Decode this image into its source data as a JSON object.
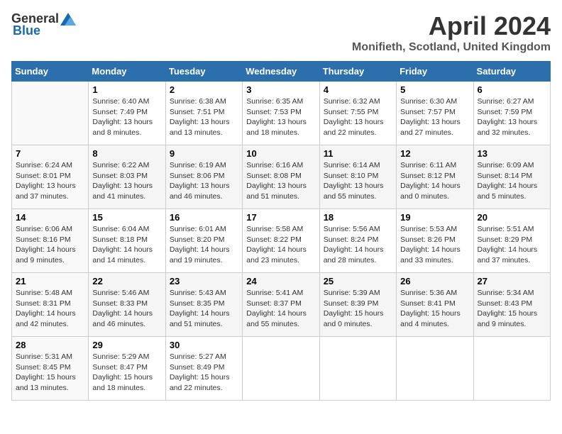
{
  "header": {
    "logo_general": "General",
    "logo_blue": "Blue",
    "month_title": "April 2024",
    "location": "Monifieth, Scotland, United Kingdom"
  },
  "days_of_week": [
    "Sunday",
    "Monday",
    "Tuesday",
    "Wednesday",
    "Thursday",
    "Friday",
    "Saturday"
  ],
  "weeks": [
    [
      {
        "num": "",
        "info": ""
      },
      {
        "num": "1",
        "info": "Sunrise: 6:40 AM\nSunset: 7:49 PM\nDaylight: 13 hours\nand 8 minutes."
      },
      {
        "num": "2",
        "info": "Sunrise: 6:38 AM\nSunset: 7:51 PM\nDaylight: 13 hours\nand 13 minutes."
      },
      {
        "num": "3",
        "info": "Sunrise: 6:35 AM\nSunset: 7:53 PM\nDaylight: 13 hours\nand 18 minutes."
      },
      {
        "num": "4",
        "info": "Sunrise: 6:32 AM\nSunset: 7:55 PM\nDaylight: 13 hours\nand 22 minutes."
      },
      {
        "num": "5",
        "info": "Sunrise: 6:30 AM\nSunset: 7:57 PM\nDaylight: 13 hours\nand 27 minutes."
      },
      {
        "num": "6",
        "info": "Sunrise: 6:27 AM\nSunset: 7:59 PM\nDaylight: 13 hours\nand 32 minutes."
      }
    ],
    [
      {
        "num": "7",
        "info": "Sunrise: 6:24 AM\nSunset: 8:01 PM\nDaylight: 13 hours\nand 37 minutes."
      },
      {
        "num": "8",
        "info": "Sunrise: 6:22 AM\nSunset: 8:03 PM\nDaylight: 13 hours\nand 41 minutes."
      },
      {
        "num": "9",
        "info": "Sunrise: 6:19 AM\nSunset: 8:06 PM\nDaylight: 13 hours\nand 46 minutes."
      },
      {
        "num": "10",
        "info": "Sunrise: 6:16 AM\nSunset: 8:08 PM\nDaylight: 13 hours\nand 51 minutes."
      },
      {
        "num": "11",
        "info": "Sunrise: 6:14 AM\nSunset: 8:10 PM\nDaylight: 13 hours\nand 55 minutes."
      },
      {
        "num": "12",
        "info": "Sunrise: 6:11 AM\nSunset: 8:12 PM\nDaylight: 14 hours\nand 0 minutes."
      },
      {
        "num": "13",
        "info": "Sunrise: 6:09 AM\nSunset: 8:14 PM\nDaylight: 14 hours\nand 5 minutes."
      }
    ],
    [
      {
        "num": "14",
        "info": "Sunrise: 6:06 AM\nSunset: 8:16 PM\nDaylight: 14 hours\nand 9 minutes."
      },
      {
        "num": "15",
        "info": "Sunrise: 6:04 AM\nSunset: 8:18 PM\nDaylight: 14 hours\nand 14 minutes."
      },
      {
        "num": "16",
        "info": "Sunrise: 6:01 AM\nSunset: 8:20 PM\nDaylight: 14 hours\nand 19 minutes."
      },
      {
        "num": "17",
        "info": "Sunrise: 5:58 AM\nSunset: 8:22 PM\nDaylight: 14 hours\nand 23 minutes."
      },
      {
        "num": "18",
        "info": "Sunrise: 5:56 AM\nSunset: 8:24 PM\nDaylight: 14 hours\nand 28 minutes."
      },
      {
        "num": "19",
        "info": "Sunrise: 5:53 AM\nSunset: 8:26 PM\nDaylight: 14 hours\nand 33 minutes."
      },
      {
        "num": "20",
        "info": "Sunrise: 5:51 AM\nSunset: 8:29 PM\nDaylight: 14 hours\nand 37 minutes."
      }
    ],
    [
      {
        "num": "21",
        "info": "Sunrise: 5:48 AM\nSunset: 8:31 PM\nDaylight: 14 hours\nand 42 minutes."
      },
      {
        "num": "22",
        "info": "Sunrise: 5:46 AM\nSunset: 8:33 PM\nDaylight: 14 hours\nand 46 minutes."
      },
      {
        "num": "23",
        "info": "Sunrise: 5:43 AM\nSunset: 8:35 PM\nDaylight: 14 hours\nand 51 minutes."
      },
      {
        "num": "24",
        "info": "Sunrise: 5:41 AM\nSunset: 8:37 PM\nDaylight: 14 hours\nand 55 minutes."
      },
      {
        "num": "25",
        "info": "Sunrise: 5:39 AM\nSunset: 8:39 PM\nDaylight: 15 hours\nand 0 minutes."
      },
      {
        "num": "26",
        "info": "Sunrise: 5:36 AM\nSunset: 8:41 PM\nDaylight: 15 hours\nand 4 minutes."
      },
      {
        "num": "27",
        "info": "Sunrise: 5:34 AM\nSunset: 8:43 PM\nDaylight: 15 hours\nand 9 minutes."
      }
    ],
    [
      {
        "num": "28",
        "info": "Sunrise: 5:31 AM\nSunset: 8:45 PM\nDaylight: 15 hours\nand 13 minutes."
      },
      {
        "num": "29",
        "info": "Sunrise: 5:29 AM\nSunset: 8:47 PM\nDaylight: 15 hours\nand 18 minutes."
      },
      {
        "num": "30",
        "info": "Sunrise: 5:27 AM\nSunset: 8:49 PM\nDaylight: 15 hours\nand 22 minutes."
      },
      {
        "num": "",
        "info": ""
      },
      {
        "num": "",
        "info": ""
      },
      {
        "num": "",
        "info": ""
      },
      {
        "num": "",
        "info": ""
      }
    ]
  ]
}
